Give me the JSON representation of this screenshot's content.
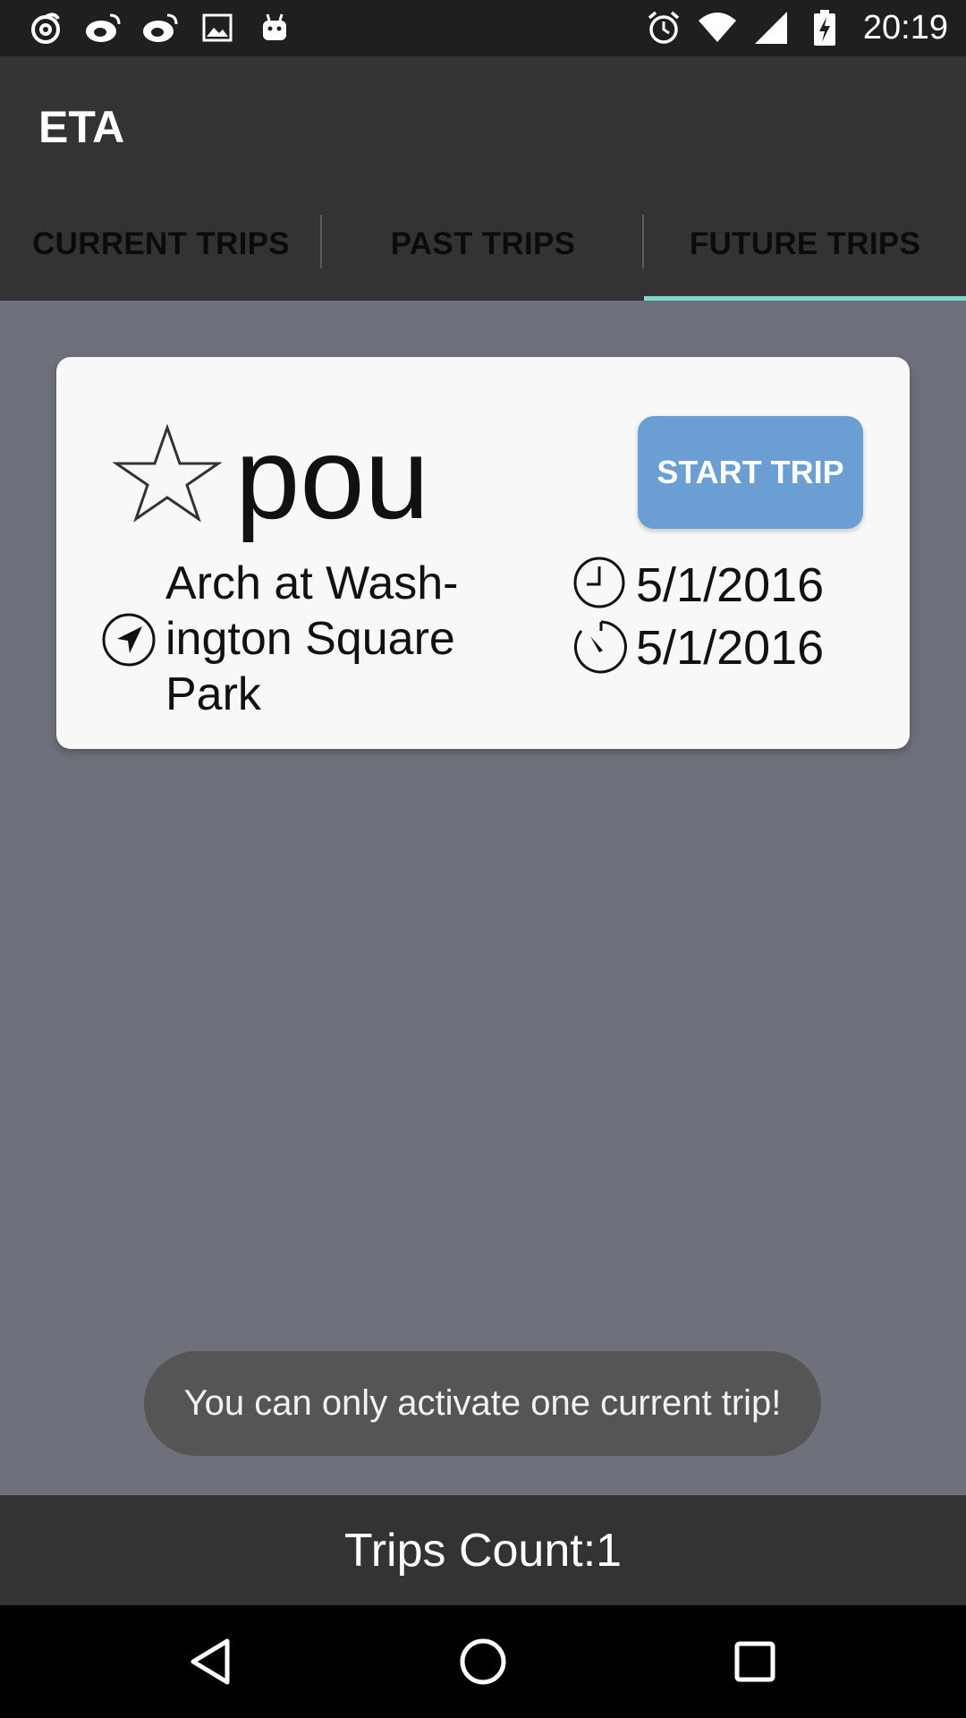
{
  "status_bar": {
    "time": "20:19",
    "left_icons": [
      "swirl-icon",
      "weibo-icon",
      "weibo-icon",
      "image-icon",
      "android-icon"
    ],
    "right_icons": [
      "alarm-icon",
      "wifi-icon",
      "signal-icon",
      "battery-charging-icon"
    ]
  },
  "app_bar": {
    "title": "ETA"
  },
  "tabs": [
    {
      "label": "CURRENT TRIPS",
      "selected": false
    },
    {
      "label": "PAST TRIPS",
      "selected": false
    },
    {
      "label": "FUTURE TRIPS",
      "selected": true
    }
  ],
  "trip": {
    "name": "pou",
    "start_button_label": "START TRIP",
    "location": "Arch at Wash-ington Square Park",
    "start_date": "5/1/2016",
    "end_date": "5/1/2016"
  },
  "toast": {
    "message": "You can only activate one current trip!"
  },
  "footer": {
    "trips_count_label": "Trips Count:1"
  },
  "colors": {
    "accent": "#7fd6cc",
    "button": "#6b9ed2",
    "app_bar": "#333333",
    "background": "#6e717b"
  }
}
